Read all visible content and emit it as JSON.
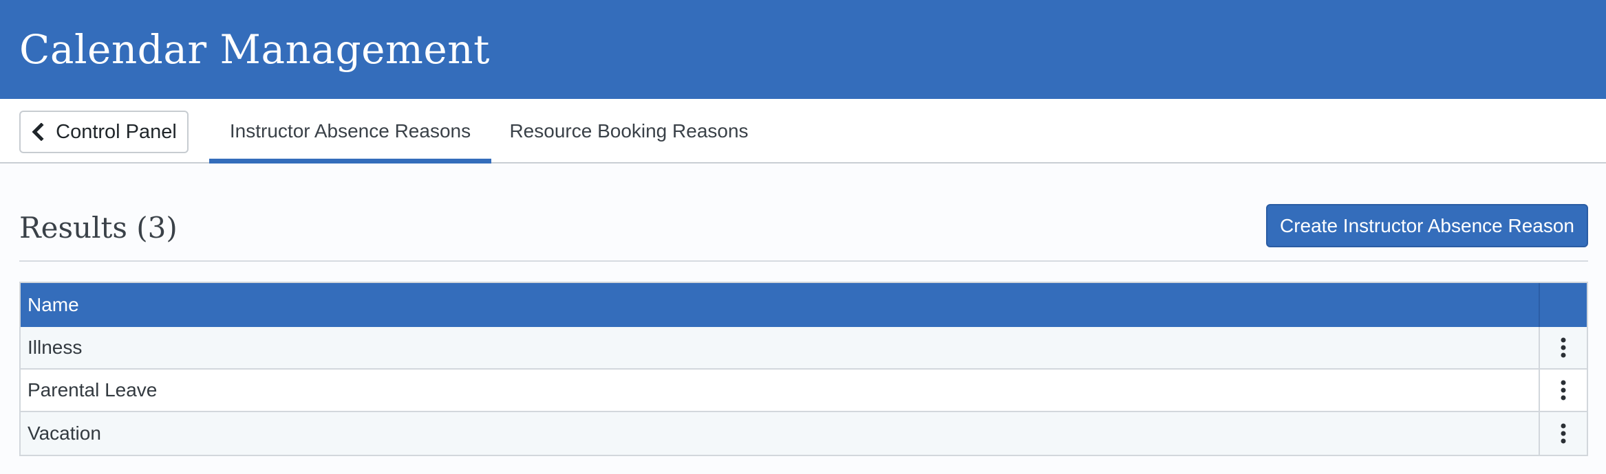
{
  "header": {
    "title": "Calendar Management"
  },
  "nav": {
    "back_label": "Control Panel",
    "back_icon": "chevron-left-icon",
    "tabs": [
      {
        "label": "Instructor Absence Reasons",
        "active": true
      },
      {
        "label": "Resource Booking Reasons",
        "active": false
      }
    ]
  },
  "results": {
    "title": "Results (3)",
    "create_label": "Create Instructor Absence Reason"
  },
  "table": {
    "columns": [
      "Name",
      ""
    ],
    "rows": [
      {
        "name": "Illness",
        "action_icon": "kebab-menu-icon"
      },
      {
        "name": "Parental Leave",
        "action_icon": "kebab-menu-icon"
      },
      {
        "name": "Vacation",
        "action_icon": "kebab-menu-icon"
      }
    ]
  },
  "colors": {
    "brand": "#346dbb",
    "background": "#fbfcfe",
    "row_alt": "#f4f8fa",
    "border": "#d2d7dc"
  }
}
